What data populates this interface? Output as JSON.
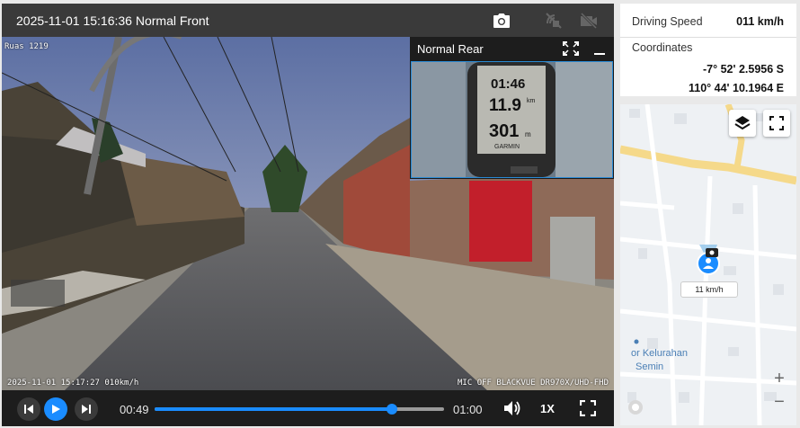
{
  "player": {
    "title": "2025-11-01 15:16:36 Normal Front",
    "icons": {
      "snapshot": "camera-icon",
      "gps_off": "satellite-off-icon",
      "camera_off": "camera-off-icon"
    },
    "osd": {
      "location": "Ruas 1219",
      "timestamp": "2025-11-01 15:17:27 010km/h",
      "device": "MIC OFF BLACKVUE DR970X/UHD-FHD"
    },
    "rear": {
      "label": "Normal Rear",
      "gps_readout": {
        "time": "01:46",
        "distance": "11.9",
        "distance_unit": "km",
        "altitude": "301",
        "altitude_unit": "m",
        "brand": "GARMIN"
      }
    },
    "controls": {
      "current_time": "00:49",
      "duration": "01:00",
      "progress": 0.82,
      "speed_label": "1X"
    }
  },
  "info": {
    "speed_label": "Driving Speed",
    "speed_value": "011 km/h",
    "coord_label": "Coordinates",
    "latitude": "-7° 52' 2.5956 S",
    "longitude": "110° 44' 10.1964 E"
  },
  "map": {
    "speed_tag": "11 km/h",
    "place_label_1": "or Kelurahan",
    "place_label_2": "Semin",
    "zoom_in": "+",
    "zoom_out": "−"
  },
  "colors": {
    "accent": "#1a8cff",
    "topbar": "#3a3a3a",
    "road_yellow": "#f5d98a"
  }
}
